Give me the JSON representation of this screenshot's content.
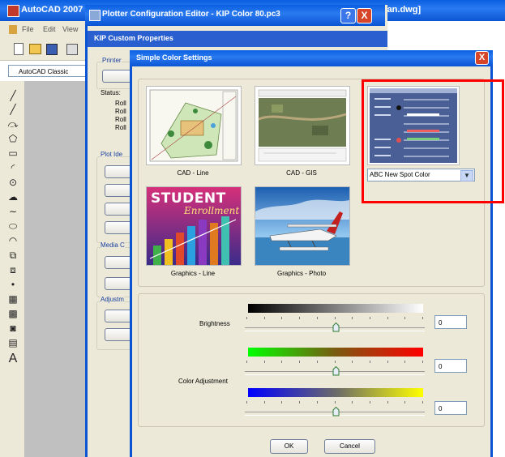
{
  "autocad": {
    "title": "AutoCAD 2007",
    "menu": [
      "File",
      "Edit",
      "View"
    ],
    "workspace": "AutoCAD Classic",
    "doc_title_fragment": "e Plan.dwg]"
  },
  "plotter_editor": {
    "title": "Plotter Configuration Editor - KIP Color 80.pc3",
    "help_label": "?",
    "close_label": "X",
    "tab": "KIP Custom Properties",
    "printer_group": "Printer",
    "status_label": "Status:",
    "roll_items": [
      "Roll",
      "Roll",
      "Roll",
      "Roll"
    ],
    "plot_group": "Plot Ide",
    "media_group": "Media C",
    "adjust_group": "Adjustm"
  },
  "dialog": {
    "title": "Simple Color Settings",
    "close_label": "X",
    "presets": [
      {
        "label": "CAD - Line"
      },
      {
        "label": "CAD - GIS"
      },
      {
        "label": "Graphics - Line"
      },
      {
        "label": "Graphics - Photo"
      }
    ],
    "student_title": "STUDENT",
    "student_sub": "Enrollment",
    "spot_select": "ABC New Spot Color",
    "brightness_label": "Brightness",
    "brightness_value": "0",
    "color_adjustment_label": "Color Adjustment",
    "color_adj_1_value": "0",
    "color_adj_2_value": "0",
    "ok_label": "OK",
    "cancel_label": "Cancel"
  },
  "colors": {
    "xp_blue": "#0b55d4",
    "dialog_bg": "#ece9d8",
    "highlight": "#ff0000"
  },
  "icons": [
    "line-icon",
    "construction-line-icon",
    "polyline-icon",
    "polygon-icon",
    "rectangle-icon",
    "arc-icon",
    "circle-icon",
    "revision-cloud-icon",
    "spline-icon",
    "ellipse-icon",
    "ellipse-arc-icon",
    "insert-block-icon",
    "make-block-icon",
    "point-icon",
    "hatch-icon",
    "gradient-icon",
    "region-icon",
    "table-icon",
    "multiline-text-icon"
  ]
}
